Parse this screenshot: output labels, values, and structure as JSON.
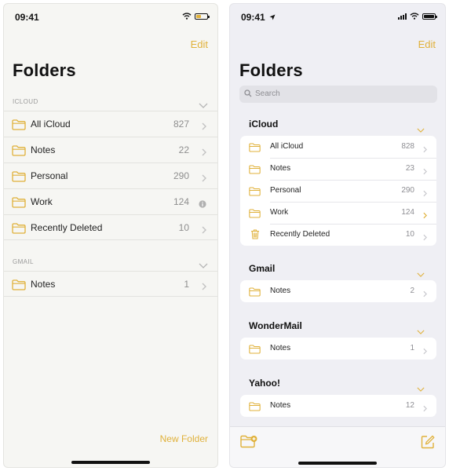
{
  "accent": "#e0b13a",
  "left": {
    "time": "09:41",
    "edit_label": "Edit",
    "title": "Folders",
    "sections": [
      {
        "label": "ICLOUD",
        "rows": [
          {
            "name": "All iCloud",
            "count": "827",
            "trail": "chevron"
          },
          {
            "name": "Notes",
            "count": "22",
            "trail": "chevron"
          },
          {
            "name": "Personal",
            "count": "290",
            "trail": "chevron"
          },
          {
            "name": "Work",
            "count": "124",
            "trail": "info"
          },
          {
            "name": "Recently Deleted",
            "count": "10",
            "trail": "chevron"
          }
        ]
      },
      {
        "label": "GMAIL",
        "rows": [
          {
            "name": "Notes",
            "count": "1",
            "trail": "chevron"
          }
        ]
      }
    ],
    "new_folder_label": "New Folder"
  },
  "right": {
    "time": "09:41",
    "edit_label": "Edit",
    "title": "Folders",
    "search_placeholder": "Search",
    "sections": [
      {
        "title": "iCloud",
        "rows": [
          {
            "name": "All iCloud",
            "count": "828",
            "icon": "folder"
          },
          {
            "name": "Notes",
            "count": "23",
            "icon": "folder"
          },
          {
            "name": "Personal",
            "count": "290",
            "icon": "folder"
          },
          {
            "name": "Work",
            "count": "124",
            "icon": "folder",
            "highlight": true
          },
          {
            "name": "Recently Deleted",
            "count": "10",
            "icon": "trash"
          }
        ]
      },
      {
        "title": "Gmail",
        "rows": [
          {
            "name": "Notes",
            "count": "2",
            "icon": "folder"
          }
        ]
      },
      {
        "title": "WonderMail",
        "rows": [
          {
            "name": "Notes",
            "count": "1",
            "icon": "folder"
          }
        ]
      },
      {
        "title": "Yahoo!",
        "rows": [
          {
            "name": "Notes",
            "count": "12",
            "icon": "folder"
          }
        ]
      }
    ],
    "toolbar": {
      "new_folder_icon": "folder-plus-icon",
      "compose_icon": "compose-icon"
    }
  }
}
